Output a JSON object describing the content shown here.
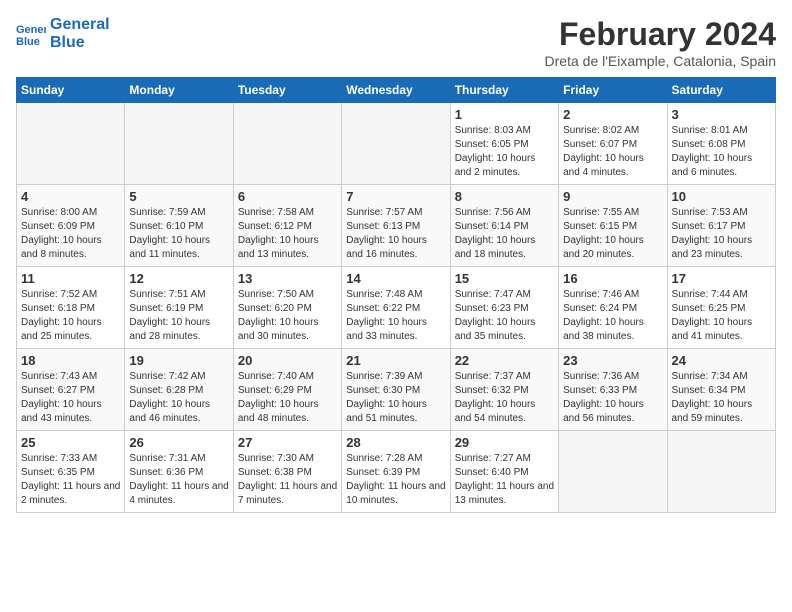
{
  "logo": {
    "line1": "General",
    "line2": "Blue"
  },
  "title": "February 2024",
  "subtitle": "Dreta de l'Eixample, Catalonia, Spain",
  "headers": [
    "Sunday",
    "Monday",
    "Tuesday",
    "Wednesday",
    "Thursday",
    "Friday",
    "Saturday"
  ],
  "weeks": [
    [
      {
        "day": "",
        "info": ""
      },
      {
        "day": "",
        "info": ""
      },
      {
        "day": "",
        "info": ""
      },
      {
        "day": "",
        "info": ""
      },
      {
        "day": "1",
        "info": "Sunrise: 8:03 AM\nSunset: 6:05 PM\nDaylight: 10 hours and 2 minutes."
      },
      {
        "day": "2",
        "info": "Sunrise: 8:02 AM\nSunset: 6:07 PM\nDaylight: 10 hours and 4 minutes."
      },
      {
        "day": "3",
        "info": "Sunrise: 8:01 AM\nSunset: 6:08 PM\nDaylight: 10 hours and 6 minutes."
      }
    ],
    [
      {
        "day": "4",
        "info": "Sunrise: 8:00 AM\nSunset: 6:09 PM\nDaylight: 10 hours and 8 minutes."
      },
      {
        "day": "5",
        "info": "Sunrise: 7:59 AM\nSunset: 6:10 PM\nDaylight: 10 hours and 11 minutes."
      },
      {
        "day": "6",
        "info": "Sunrise: 7:58 AM\nSunset: 6:12 PM\nDaylight: 10 hours and 13 minutes."
      },
      {
        "day": "7",
        "info": "Sunrise: 7:57 AM\nSunset: 6:13 PM\nDaylight: 10 hours and 16 minutes."
      },
      {
        "day": "8",
        "info": "Sunrise: 7:56 AM\nSunset: 6:14 PM\nDaylight: 10 hours and 18 minutes."
      },
      {
        "day": "9",
        "info": "Sunrise: 7:55 AM\nSunset: 6:15 PM\nDaylight: 10 hours and 20 minutes."
      },
      {
        "day": "10",
        "info": "Sunrise: 7:53 AM\nSunset: 6:17 PM\nDaylight: 10 hours and 23 minutes."
      }
    ],
    [
      {
        "day": "11",
        "info": "Sunrise: 7:52 AM\nSunset: 6:18 PM\nDaylight: 10 hours and 25 minutes."
      },
      {
        "day": "12",
        "info": "Sunrise: 7:51 AM\nSunset: 6:19 PM\nDaylight: 10 hours and 28 minutes."
      },
      {
        "day": "13",
        "info": "Sunrise: 7:50 AM\nSunset: 6:20 PM\nDaylight: 10 hours and 30 minutes."
      },
      {
        "day": "14",
        "info": "Sunrise: 7:48 AM\nSunset: 6:22 PM\nDaylight: 10 hours and 33 minutes."
      },
      {
        "day": "15",
        "info": "Sunrise: 7:47 AM\nSunset: 6:23 PM\nDaylight: 10 hours and 35 minutes."
      },
      {
        "day": "16",
        "info": "Sunrise: 7:46 AM\nSunset: 6:24 PM\nDaylight: 10 hours and 38 minutes."
      },
      {
        "day": "17",
        "info": "Sunrise: 7:44 AM\nSunset: 6:25 PM\nDaylight: 10 hours and 41 minutes."
      }
    ],
    [
      {
        "day": "18",
        "info": "Sunrise: 7:43 AM\nSunset: 6:27 PM\nDaylight: 10 hours and 43 minutes."
      },
      {
        "day": "19",
        "info": "Sunrise: 7:42 AM\nSunset: 6:28 PM\nDaylight: 10 hours and 46 minutes."
      },
      {
        "day": "20",
        "info": "Sunrise: 7:40 AM\nSunset: 6:29 PM\nDaylight: 10 hours and 48 minutes."
      },
      {
        "day": "21",
        "info": "Sunrise: 7:39 AM\nSunset: 6:30 PM\nDaylight: 10 hours and 51 minutes."
      },
      {
        "day": "22",
        "info": "Sunrise: 7:37 AM\nSunset: 6:32 PM\nDaylight: 10 hours and 54 minutes."
      },
      {
        "day": "23",
        "info": "Sunrise: 7:36 AM\nSunset: 6:33 PM\nDaylight: 10 hours and 56 minutes."
      },
      {
        "day": "24",
        "info": "Sunrise: 7:34 AM\nSunset: 6:34 PM\nDaylight: 10 hours and 59 minutes."
      }
    ],
    [
      {
        "day": "25",
        "info": "Sunrise: 7:33 AM\nSunset: 6:35 PM\nDaylight: 11 hours and 2 minutes."
      },
      {
        "day": "26",
        "info": "Sunrise: 7:31 AM\nSunset: 6:36 PM\nDaylight: 11 hours and 4 minutes."
      },
      {
        "day": "27",
        "info": "Sunrise: 7:30 AM\nSunset: 6:38 PM\nDaylight: 11 hours and 7 minutes."
      },
      {
        "day": "28",
        "info": "Sunrise: 7:28 AM\nSunset: 6:39 PM\nDaylight: 11 hours and 10 minutes."
      },
      {
        "day": "29",
        "info": "Sunrise: 7:27 AM\nSunset: 6:40 PM\nDaylight: 11 hours and 13 minutes."
      },
      {
        "day": "",
        "info": ""
      },
      {
        "day": "",
        "info": ""
      }
    ]
  ]
}
